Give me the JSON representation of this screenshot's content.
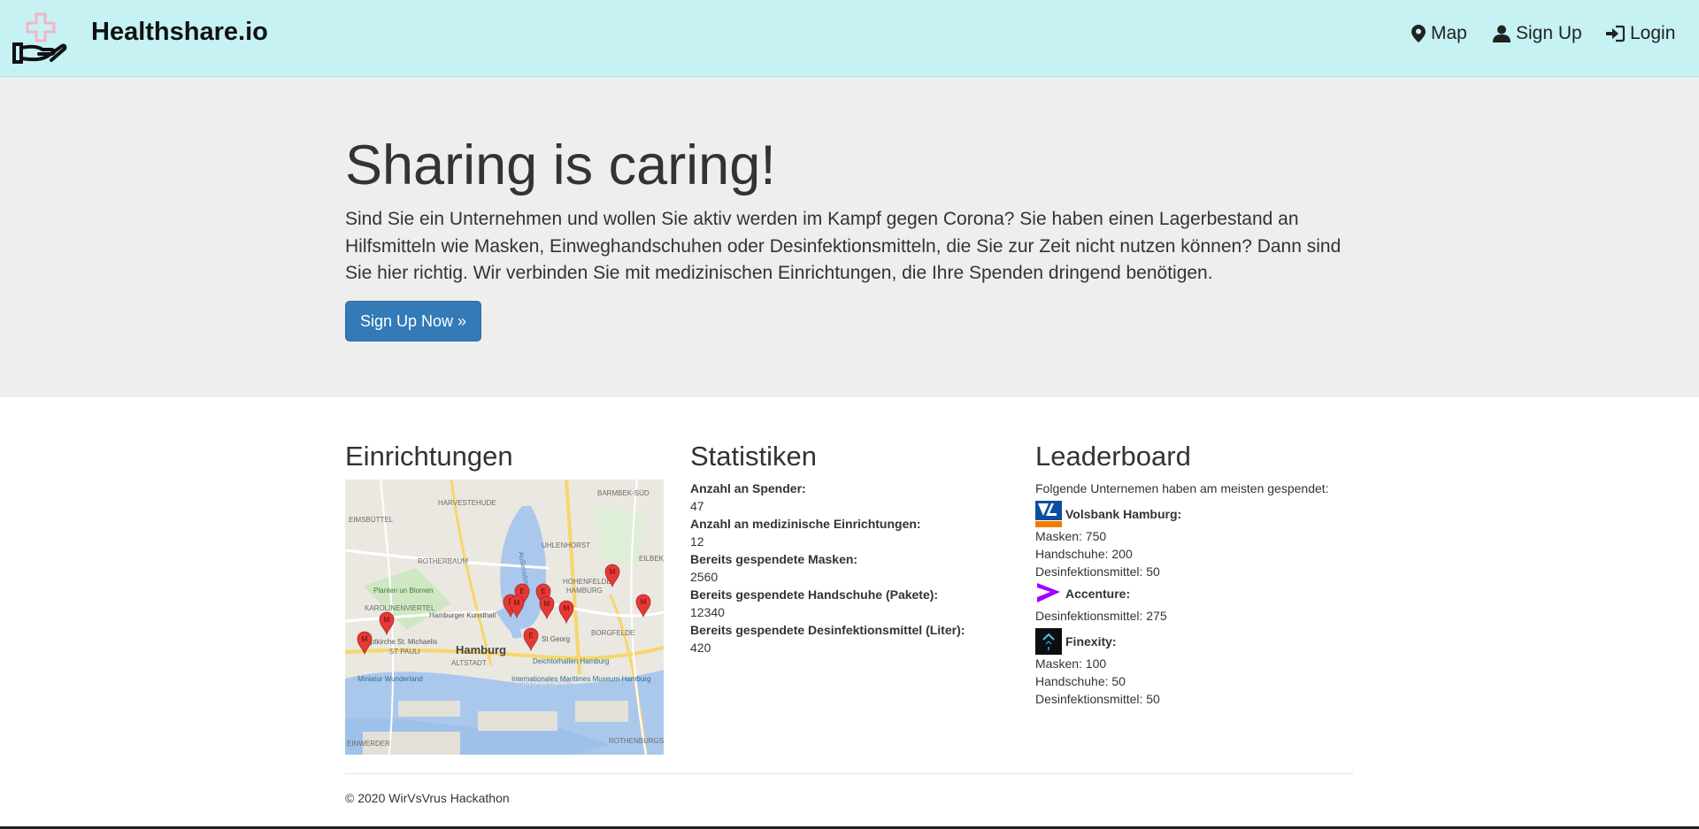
{
  "navbar": {
    "brand": "Healthshare.io",
    "items": [
      {
        "label": "Map",
        "icon": "map-marker-icon"
      },
      {
        "label": "Sign Up",
        "icon": "user-icon"
      },
      {
        "label": "Login",
        "icon": "login-icon"
      }
    ]
  },
  "hero": {
    "title": "Sharing is caring!",
    "text": "Sind Sie ein Unternehmen und wollen Sie aktiv werden im Kampf gegen Corona? Sie haben einen Lagerbestand an Hilfsmitteln wie Masken, Einweghandschuhen oder Desinfektionsmitteln, die Sie zur Zeit nicht nutzen können? Dann sind Sie hier richtig. Wir verbinden Sie mit medizinischen Einrichtungen, die Ihre Spenden dringend benötigen.",
    "button_label": "Sign Up Now »"
  },
  "einrichtungen": {
    "heading": "Einrichtungen",
    "map_labels": {
      "city": "Hamburg",
      "districts": [
        "HARVESTEHUDE",
        "BARMBEK-SÜD",
        "EIMSBÜTTEL",
        "UHLENHORST",
        "ROTHERBAUM",
        "EILBEK",
        "HOHENFELDE",
        "HAMBURG",
        "KAROLINENVIERTEL",
        "BORGFELDE",
        "ST PAULI",
        "ALTSTADT",
        "HAFENCITY",
        "EINWERDER",
        "ROTHENBURGSO"
      ],
      "pois": [
        "Planten un Blomen",
        "Hamburger Kunsthall",
        "Hauptkirche St. Michaelis",
        "St Georg",
        "Deichtorhallen Hamburg",
        "Miniatur Wunderland",
        "Internationales Maritimes Museum Hamburg"
      ],
      "water": "Außenalster"
    },
    "marker_labels": [
      "M",
      "M",
      "M",
      "E",
      "E",
      "E",
      "M",
      "M",
      "M",
      "M",
      "E"
    ]
  },
  "statistiken": {
    "heading": "Statistiken",
    "items": [
      {
        "label": "Anzahl an Spender:",
        "value": "47"
      },
      {
        "label": "Anzahl an medizinische Einrichtungen:",
        "value": "12"
      },
      {
        "label": "Bereits gespendete Masken:",
        "value": "2560"
      },
      {
        "label": "Bereits gespendete Handschuhe (Pakete):",
        "value": "12340"
      },
      {
        "label": "Bereits gespendete Desinfektionsmittel (Liter):",
        "value": "420"
      }
    ]
  },
  "leaderboard": {
    "heading": "Leaderboard",
    "intro": "Folgende Unternemen haben am meisten gespendet:",
    "companies": [
      {
        "name": "Volsbank Hamburg:",
        "lines": [
          "Masken: 750",
          "Handschuhe: 200",
          "Desinfektionsmittel: 50"
        ]
      },
      {
        "name": "Accenture:",
        "lines": [
          "Desinfektionsmittel: 275"
        ]
      },
      {
        "name": "Finexity:",
        "lines": [
          "Masken: 100",
          "Handschuhe: 50",
          "Desinfektionsmittel: 50"
        ]
      }
    ]
  },
  "footer": {
    "text": "© 2020 WirVsVrus Hackathon"
  },
  "colors": {
    "navbar_bg": "#c6f2f4",
    "button": "#337ab7",
    "jumbotron_bg": "#eeeeee",
    "marker": "#e53935"
  }
}
